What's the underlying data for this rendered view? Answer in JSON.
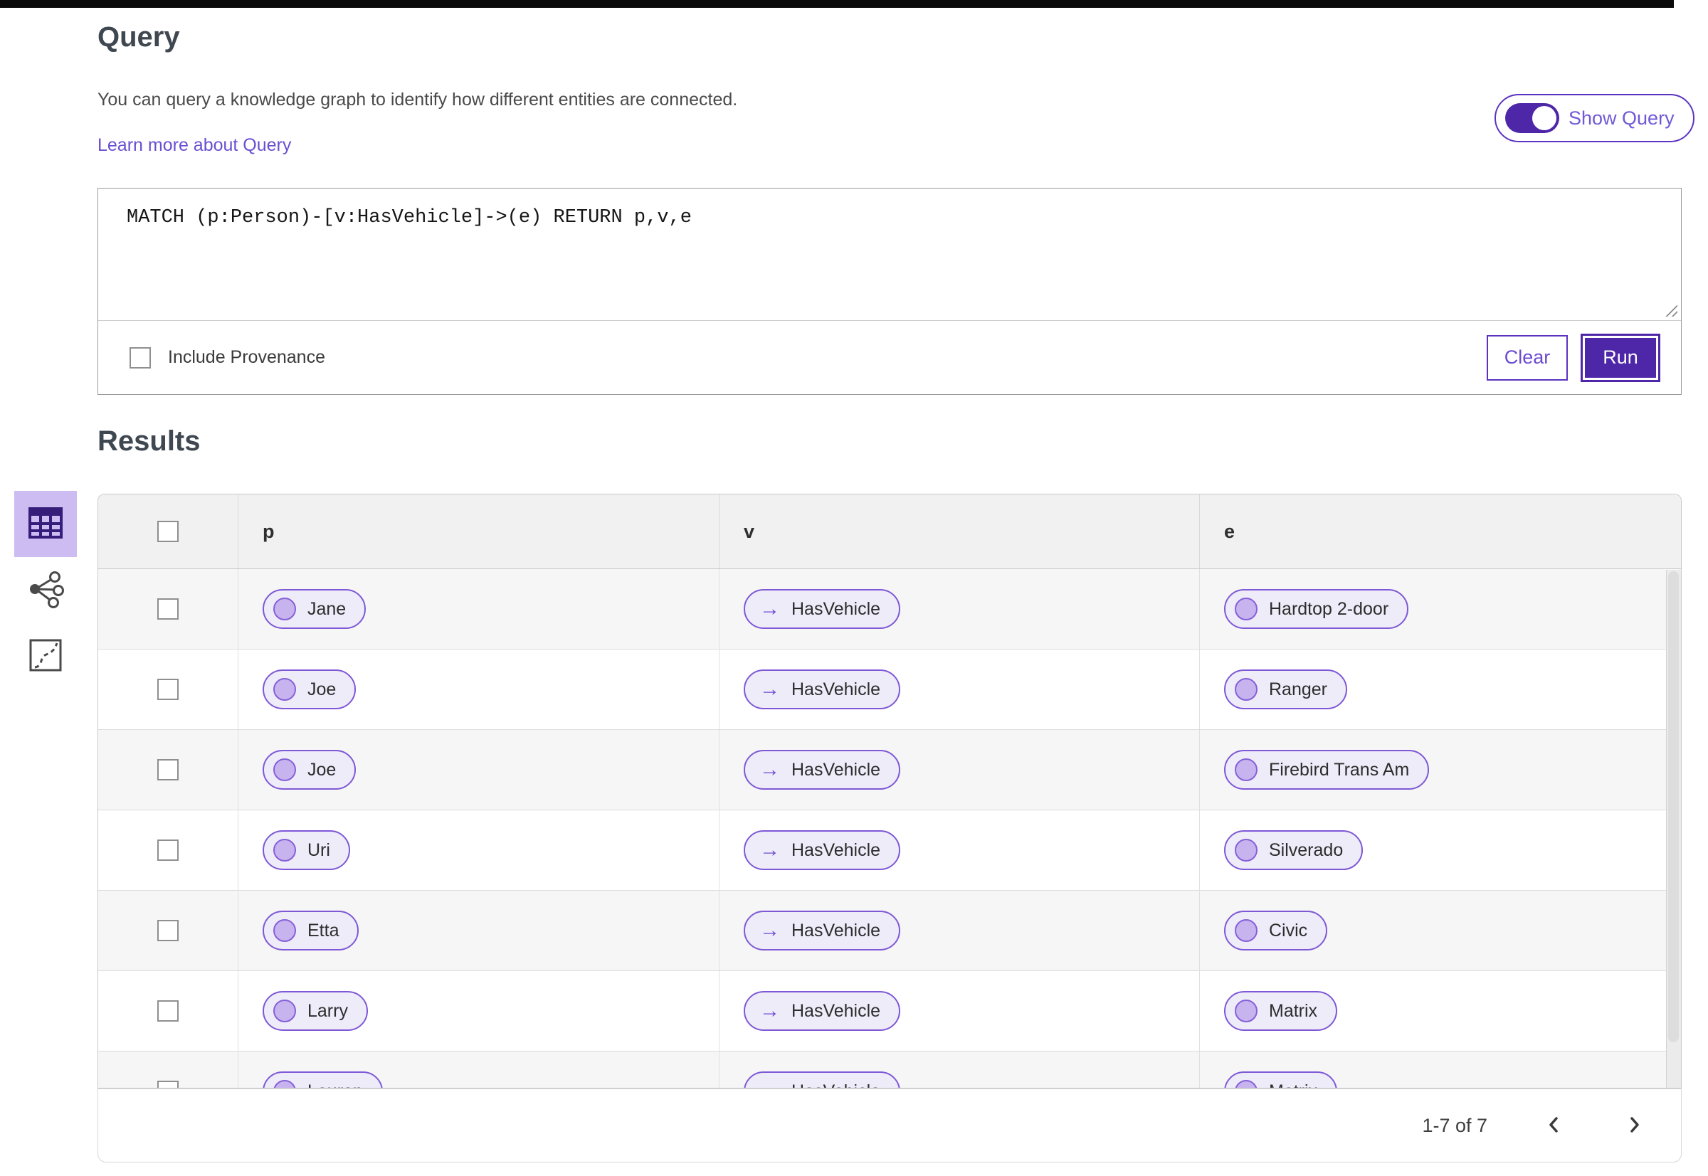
{
  "header": {
    "title": "Query",
    "description": "You can query a knowledge graph to identify how different entities are connected.",
    "learn_more_link": "Learn more about Query",
    "show_query_label": "Show Query",
    "show_query_on": true
  },
  "query_editor": {
    "query_text": "MATCH (p:Person)-[v:HasVehicle]->(e) RETURN p,v,e",
    "include_provenance_label": "Include Provenance",
    "include_provenance_checked": false,
    "clear_label": "Clear",
    "run_label": "Run"
  },
  "results": {
    "heading": "Results",
    "view_buttons": [
      {
        "name": "table-view",
        "icon": "table-icon",
        "selected": true
      },
      {
        "name": "graph-view",
        "icon": "network-icon",
        "selected": false
      },
      {
        "name": "diagram-view",
        "icon": "route-icon",
        "selected": false
      }
    ],
    "columns": [
      "p",
      "v",
      "e"
    ],
    "relation_arrow": "→",
    "rows": [
      {
        "p": "Jane",
        "v": "HasVehicle",
        "e": "Hardtop 2-door"
      },
      {
        "p": "Joe",
        "v": "HasVehicle",
        "e": "Ranger"
      },
      {
        "p": "Joe",
        "v": "HasVehicle",
        "e": "Firebird Trans Am"
      },
      {
        "p": "Uri",
        "v": "HasVehicle",
        "e": "Silverado"
      },
      {
        "p": "Etta",
        "v": "HasVehicle",
        "e": "Civic"
      },
      {
        "p": "Larry",
        "v": "HasVehicle",
        "e": "Matrix"
      },
      {
        "p": "Lauren",
        "v": "HasVehicle",
        "e": "Matrix"
      }
    ],
    "pagination": {
      "range_label": "1-7 of 7"
    }
  },
  "theme": {
    "accent_deep": "#4e26a8",
    "accent_border": "#5c33c0",
    "chip_border": "#7e58d6",
    "chip_bg": "#efecfa",
    "chip_dot": "#c7b4ee",
    "chip_dot_border": "#8560d8",
    "link": "#6a4fd1",
    "selected_view_bg": "#cdbcf2",
    "header_bg": "#f1f1f1",
    "row_alt_bg": "#f6f6f6",
    "table_border": "#c9c9c9",
    "top_bar": "#0a0a0a"
  }
}
